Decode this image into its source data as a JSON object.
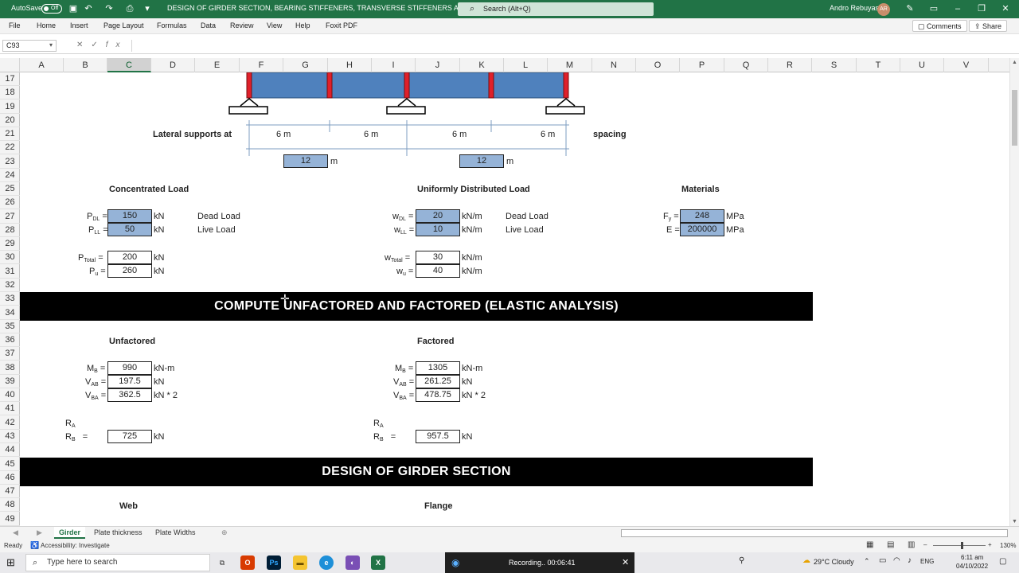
{
  "window": {
    "autosave_label": "AutoSave",
    "autosave_state": "Off",
    "title": "DESIGN OF GIRDER SECTION, BEARING STIFFENERS, TRANSVERSE STIFFENERS AND FILLET WELD",
    "search_placeholder": "Search (Alt+Q)",
    "user_name": "Andro Rebuyas",
    "user_initials": "AR"
  },
  "menu": {
    "items": [
      "File",
      "Home",
      "Insert",
      "Page Layout",
      "Formulas",
      "Data",
      "Review",
      "View",
      "Help",
      "Foxit PDF"
    ],
    "comments_label": "Comments",
    "share_label": "Share"
  },
  "formula_bar": {
    "name_box": "C93",
    "formula": ""
  },
  "columns": [
    "A",
    "B",
    "C",
    "D",
    "E",
    "F",
    "G",
    "H",
    "I",
    "J",
    "K",
    "L",
    "M",
    "N",
    "O",
    "P",
    "Q",
    "R",
    "S",
    "T",
    "U",
    "V"
  ],
  "rows": [
    "17",
    "18",
    "19",
    "20",
    "21",
    "22",
    "23",
    "24",
    "25",
    "26",
    "27",
    "28",
    "29",
    "30",
    "31",
    "32",
    "33",
    "34",
    "35",
    "36",
    "37",
    "38",
    "39",
    "40",
    "41",
    "42",
    "43",
    "44",
    "45",
    "46",
    "47",
    "48",
    "49"
  ],
  "beam": {
    "lateral_label": "Lateral supports at",
    "spacing_label": "spacing",
    "spans": [
      "6  m",
      "6  m",
      "6  m",
      "6  m"
    ],
    "span_totals": [
      {
        "value": "12",
        "unit": "m"
      },
      {
        "value": "12",
        "unit": "m"
      }
    ]
  },
  "concentrated": {
    "title": "Concentrated Load",
    "pdl_value": "150",
    "pdl_unit": "kN",
    "pdl_desc": "Dead Load",
    "pll_value": "50",
    "pll_unit": "kN",
    "pll_desc": "Live Load",
    "ptotal_value": "200",
    "ptotal_unit": "kN",
    "pu_value": "260",
    "pu_unit": "kN"
  },
  "distributed": {
    "title": "Uniformly Distributed Load",
    "wdl_value": "20",
    "wdl_unit": "kN/m",
    "wdl_desc": "Dead Load",
    "wll_value": "10",
    "wll_unit": "kN/m",
    "wll_desc": "Live Load",
    "wtotal_value": "30",
    "wtotal_unit": "kN/m",
    "wu_value": "40",
    "wu_unit": "kN/m"
  },
  "materials": {
    "title": "Materials",
    "fy_value": "248",
    "fy_unit": "MPa",
    "e_label": "E =",
    "e_value": "200000",
    "e_unit": "MPa"
  },
  "section_compute": {
    "title": "COMPUTE UNFACTORED AND FACTORED (ELASTIC ANALYSIS)"
  },
  "unfactored": {
    "title": "Unfactored",
    "mb_value": "990",
    "mb_unit": "kN-m",
    "vab_value": "197.5",
    "vab_unit": "kN",
    "vba_value": "362.5",
    "vba_unit": "kN * 2",
    "rb_value": "725",
    "rb_unit": "kN"
  },
  "factored": {
    "title": "Factored",
    "mb_value": "1305",
    "mb_unit": "kN-m",
    "vab_value": "261.25",
    "vab_unit": "kN",
    "vba_value": "478.75",
    "vba_unit": "kN * 2",
    "rb_value": "957.5",
    "rb_unit": "kN"
  },
  "section_design": {
    "title": "DESIGN OF GIRDER SECTION"
  },
  "design_labels": {
    "web": "Web",
    "flange": "Flange"
  },
  "sheet_tabs": [
    "Girder",
    "Plate thickness",
    "Plate Widths"
  ],
  "status": {
    "ready": "Ready",
    "accessibility": "Accessibility: Investigate",
    "zoom": "130%"
  },
  "taskbar": {
    "search_placeholder": "Type here to search",
    "recording_text": "Recording..  00:06:41",
    "weather": "29°C  Cloudy",
    "lang": "ENG",
    "time": "6:11 am",
    "date": "04/10/2022"
  },
  "colors": {
    "excel_green": "#217346",
    "input_blue": "#95b3d7",
    "beam_blue": "#4f81bd",
    "stiffener_red": "#e0202a"
  }
}
